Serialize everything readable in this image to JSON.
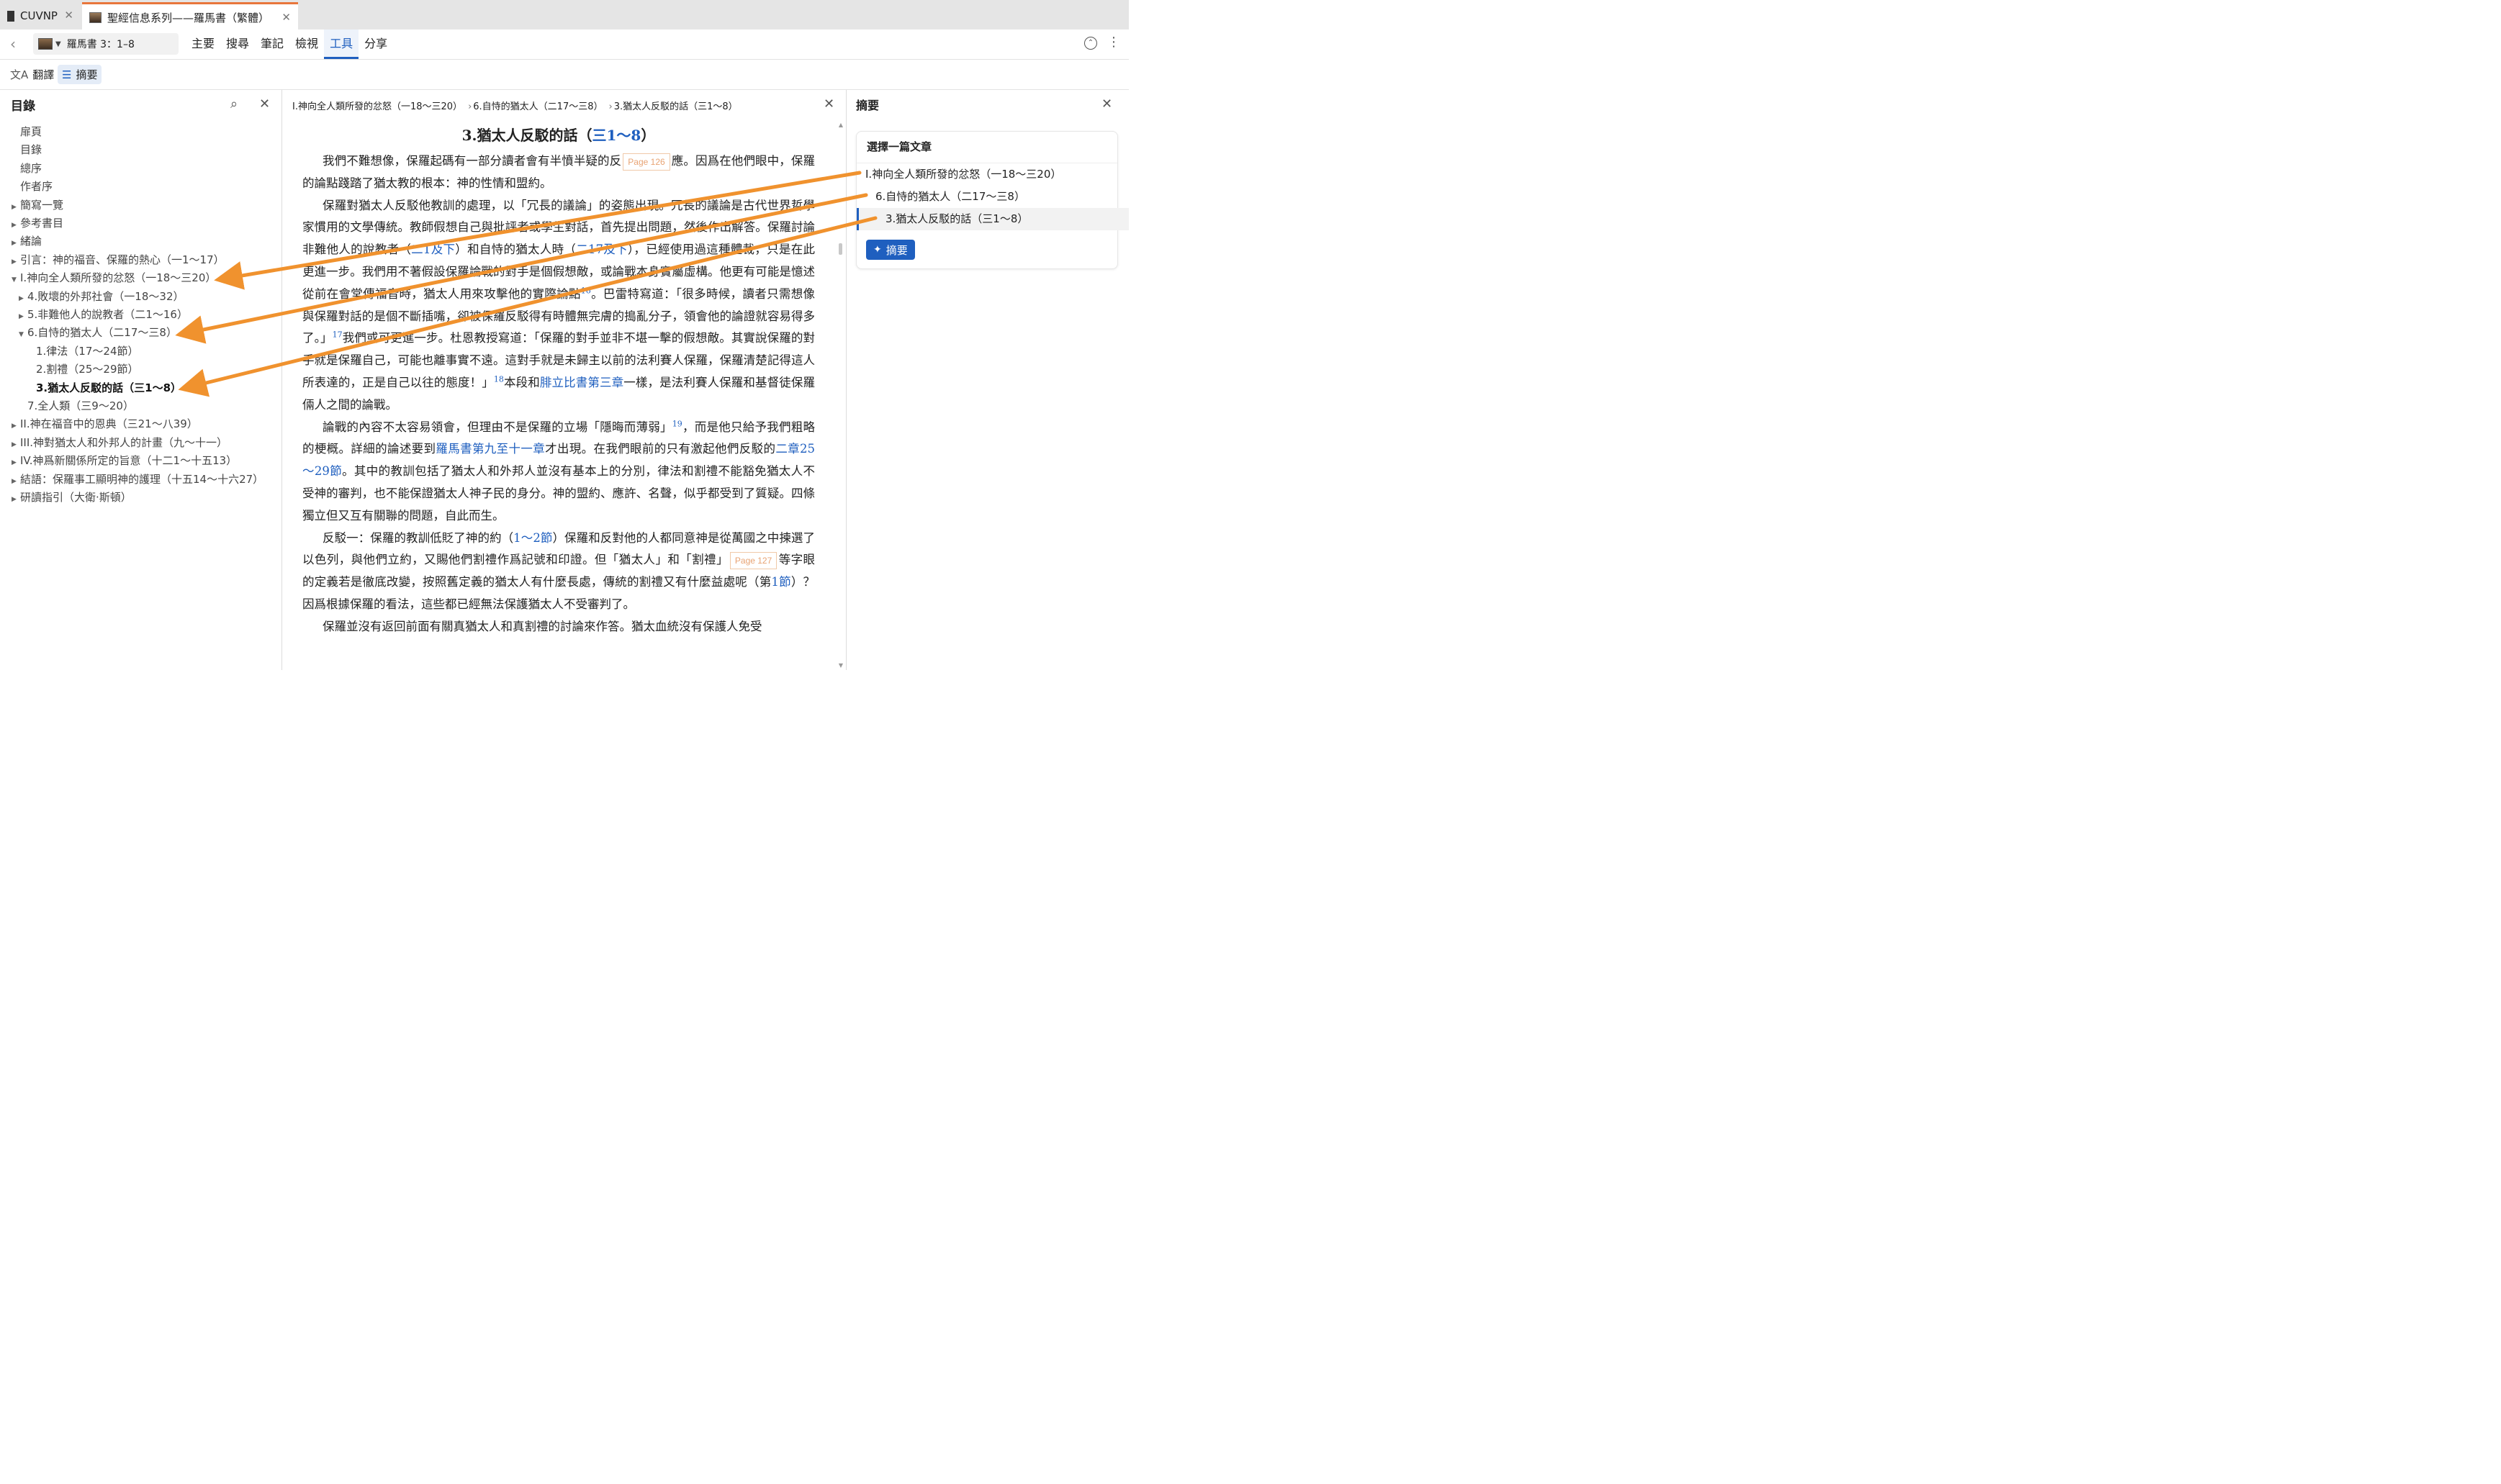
{
  "tabs": [
    {
      "label": "CUVNP",
      "close": "✕"
    },
    {
      "label": "聖經信息系列——羅馬書（繁體）",
      "close": "✕"
    }
  ],
  "toolbar": {
    "back": "‹",
    "resource_label": "羅馬書 3：1–8",
    "menu": [
      "主要",
      "搜尋",
      "筆記",
      "檢視",
      "工具",
      "分享"
    ],
    "active_menu_index": 4
  },
  "subtoolbar": {
    "translate": "翻譯",
    "summary": "摘要"
  },
  "toc": {
    "title": "目錄",
    "items": [
      {
        "label": "扉頁",
        "indent": 0,
        "arrow": ""
      },
      {
        "label": "目錄",
        "indent": 0,
        "arrow": ""
      },
      {
        "label": "總序",
        "indent": 0,
        "arrow": ""
      },
      {
        "label": "作者序",
        "indent": 0,
        "arrow": ""
      },
      {
        "label": "簡寫一覽",
        "indent": 0,
        "arrow": "▶"
      },
      {
        "label": "參考書目",
        "indent": 0,
        "arrow": "▶"
      },
      {
        "label": "緒論",
        "indent": 0,
        "arrow": "▶"
      },
      {
        "label": "引言：神的福音、保羅的熱心（一1～17）",
        "indent": 0,
        "arrow": "▶"
      },
      {
        "label": "I.神向全人類所發的忿怒（一18～三20）",
        "indent": 0,
        "arrow": "▼"
      },
      {
        "label": "4.敗壞的外邦社會（一18～32）",
        "indent": 1,
        "arrow": "▶"
      },
      {
        "label": "5.非難他人的說教者（二1～16）",
        "indent": 1,
        "arrow": "▶"
      },
      {
        "label": "6.自恃的猶太人（二17～三8）",
        "indent": 1,
        "arrow": "▼"
      },
      {
        "label": "1.律法（17～24節）",
        "indent": 2,
        "arrow": ""
      },
      {
        "label": "2.割禮（25～29節）",
        "indent": 2,
        "arrow": ""
      },
      {
        "label": "3.猶太人反駁的話（三1～8）",
        "indent": 2,
        "arrow": "",
        "current": true
      },
      {
        "label": "7.全人類（三9～20）",
        "indent": 1,
        "arrow": ""
      },
      {
        "label": "II.神在福音中的恩典（三21～八39）",
        "indent": 0,
        "arrow": "▶"
      },
      {
        "label": "III.神對猶太人和外邦人的計畫（九～十一）",
        "indent": 0,
        "arrow": "▶"
      },
      {
        "label": "IV.神爲新關係所定的旨意（十二1～十五13）",
        "indent": 0,
        "arrow": "▶"
      },
      {
        "label": "結語：保羅事工顯明神的護理（十五14～十六27）",
        "indent": 0,
        "arrow": "▶"
      },
      {
        "label": "研讀指引（大衛·斯頓）",
        "indent": 0,
        "arrow": "▶"
      }
    ]
  },
  "breadcrumb": [
    "I.神向全人類所發的忿怒（一18～三20）",
    "6.自恃的猶太人（二17～三8）",
    "3.猶太人反駁的話（三1～8）"
  ],
  "article": {
    "title_prefix": "3.猶太人反駁的話（",
    "title_link": "三1～8",
    "title_suffix": "）",
    "p1_a": "我們不難想像，保羅起碼有一部分讀者會有半憤半疑的反",
    "page126": "Page 126",
    "p1_b": "應。因爲在他們眼中，保羅的論點踐踏了猶太教的根本：神的性情和盟約。",
    "p2_a": "保羅對猶太人反駁他教訓的處理，以「冗長的議論」的姿態出現。冗長的議論是古代世界哲學家慣用的文學傳統。教師假想自己與批評者或學生對話，首先提出問題，然後作出解答。保羅討論非難他人的說教者（",
    "p2_link1": "二1及下",
    "p2_b": "）和自恃的猶太人時（",
    "p2_link2": "二17及下",
    "p2_c": "），已經使用過這種體裁，只是在此更進一步。我們用不著假設保羅論戰的對手是個假想敵，或論戰本身實屬虛構。他更有可能是憶述從前在會堂傳福音時，猶太人用來攻擊他的實際論點",
    "sup16": "16",
    "p2_d": "。巴雷特寫道：「很多時候，讀者只需想像與保羅對話的是個不斷插嘴，卻被保羅反駁得有時體無完膚的搗亂分子，領會他的論證就容易得多了。」",
    "sup17": "17",
    "p2_e": "我們或可更進一步。杜恩教授寫道：「保羅的對手並非不堪一擊的假想敵。其實說保羅的對手就是保羅自己，可能也離事實不遠。這對手就是未歸主以前的法利賽人保羅，保羅清楚記得這人所表達的，正是自己以往的態度！」",
    "sup18": "18",
    "p2_f": "本段和",
    "p2_link3": "腓立比書第三章",
    "p2_g": "一樣，是法利賽人保羅和基督徒保羅倆人之間的論戰。",
    "p3_a": "論戰的內容不太容易領會，但理由不是保羅的立場「隱晦而薄弱」",
    "sup19": "19",
    "p3_b": "，而是他只給予我們粗略的梗概。詳細的論述要到",
    "p3_link1": "羅馬書第九至十一章",
    "p3_c": "才出現。在我們眼前的只有激起他們反駁的",
    "p3_link2": "二章25～29節",
    "p3_d": "。其中的教訓包括了猶太人和外邦人並沒有基本上的分別，律法和割禮不能豁免猶太人不受神的審判，也不能保證猶太人神子民的身分。神的盟約、應許、名聲，似乎都受到了質疑。四條獨立但又互有關聯的問題，自此而生。",
    "p4_a": "反駁一：保羅的教訓低貶了神的約（",
    "p4_link1": "1～2節",
    "p4_b": "）保羅和反對他的人都同意神是從萬國之中揀選了以色列，與他們立約，又賜他們割禮作爲記號和印證。但「猶太人」和「割禮」",
    "page127": "Page 127",
    "p4_c": "等字眼的定義若是徹底改變，按照舊定義的猶太人有什麼長處，傳統的割禮又有什麼益處呢（第",
    "p4_link2": "1節",
    "p4_d": "）？因爲根據保羅的看法，這些都已經無法保護猶太人不受審判了。",
    "p5_a": "保羅並沒有返回前面有關真猶太人和真割禮的討論來作答。猶太血統沒有保護人免受"
  },
  "summary_panel": {
    "title": "摘要",
    "card_title": "選擇一篇文章",
    "items": [
      "I.神向全人類所發的忿怒（一18～三20）",
      "6.自恃的猶太人（二17～三8）",
      "3.猶太人反駁的話（三1～8）"
    ],
    "selected_index": 2,
    "button": "摘要"
  },
  "colors": {
    "accent": "#1f5fbf",
    "tab_highlight": "#e8763b",
    "annotation_arrow": "#f0922e",
    "page_marker": "#e8a373"
  }
}
